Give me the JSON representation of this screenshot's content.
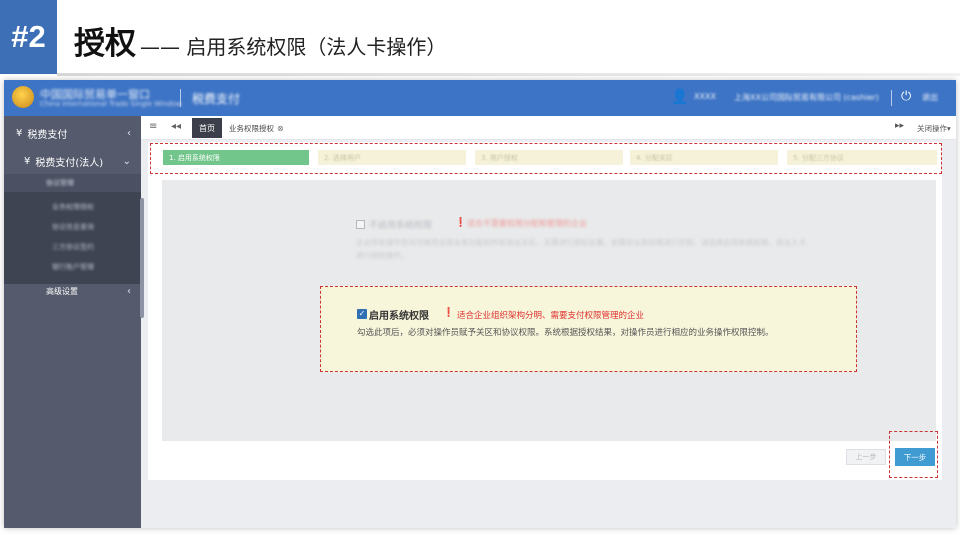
{
  "slide": {
    "number": "#2",
    "title": "授权",
    "subtitle": "—— 启用系统权限（法人卡操作）"
  },
  "topbar": {
    "logo_text": "中国国际贸易单一窗口",
    "logo_subtext": "China International Trade Single Window",
    "module": "税费支付",
    "user_name": "XXXX",
    "user_org": "上海XX公司国际贸易有限公司 (cashier)",
    "logout": "退出"
  },
  "sidebar": {
    "item1": "税费支付",
    "item2": "税费支付(法人)",
    "sub_head": "协议管理",
    "sub_items": [
      "业务权限授权",
      "协议信息查询",
      "三方协议签约",
      "银行账户管理"
    ],
    "advanced": "高级设置"
  },
  "tabs": {
    "home": "首页",
    "auth": "业务权限授权",
    "close_ops": "关闭操作▾"
  },
  "steps": [
    {
      "label": "1. 启用系统权限"
    },
    {
      "label": "2. 选择用户"
    },
    {
      "label": "3. 用户授权"
    },
    {
      "label": "4. 分配关区"
    },
    {
      "label": "5. 分配三方协议"
    }
  ],
  "option1": {
    "label": "不启用系统权限",
    "warn": "适合不需要权限分配和管理的企业",
    "desc": "企业所有操作员均可使用全部业务功能和所有协议关区，无需进行授权设置。如需对业务权限进行控制，请选择启用系统权限，由法人卡进行授权操作。"
  },
  "option2": {
    "label": "启用系统权限",
    "warn": "适合企业组织架构分明、需要支付权限管理的企业",
    "desc": "勾选此项后，必须对操作员赋予关区和协议权限。系统根据授权结果，对操作员进行相应的业务操作权限控制。"
  },
  "buttons": {
    "prev": "上一步",
    "next": "下一步"
  },
  "icons": {
    "yen": "¥",
    "chevron_left": "‹",
    "chevron_down": "⌄",
    "menu": "≡",
    "rewind": "◂◂",
    "forward": "▸▸",
    "close": "⊗",
    "user": "👤",
    "power": "⏻",
    "check": "✓",
    "info": "❗"
  },
  "colors": {
    "badge": "#3d6fb6",
    "topbar": "#3d74c5",
    "sidebar": "#555b6c",
    "step_active": "#72c58b",
    "step_pending": "#f5f2d9",
    "highlight_dash": "#cc3333",
    "warn_red": "#e03030",
    "next_button": "#3f9bd2"
  }
}
